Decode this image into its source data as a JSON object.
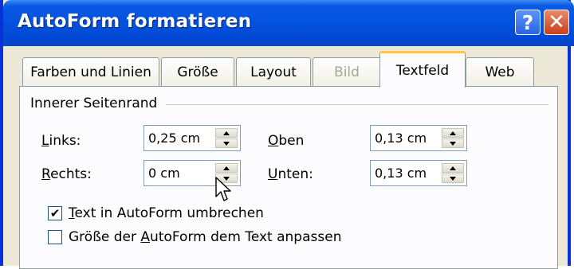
{
  "window": {
    "title": "AutoForm formatieren"
  },
  "titlebar_buttons": {
    "help": "?",
    "close": "✕"
  },
  "tabs": [
    {
      "label": "Farben und Linien",
      "state": "normal"
    },
    {
      "label": "Größe",
      "state": "normal"
    },
    {
      "label": "Layout",
      "state": "normal"
    },
    {
      "label": "Bild",
      "state": "disabled"
    },
    {
      "label": "Textfeld",
      "state": "active"
    },
    {
      "label": "Web",
      "state": "normal"
    }
  ],
  "margin_group": {
    "title": "Innerer Seitenrand",
    "links": {
      "pre": "",
      "key": "L",
      "rest": "inks:",
      "value": "0,25 cm"
    },
    "rechts": {
      "pre": "",
      "key": "R",
      "rest": "echts:",
      "value": "0 cm"
    },
    "oben": {
      "pre": "",
      "key": "O",
      "rest": "ben",
      "value": "0,13 cm"
    },
    "unten": {
      "pre": "",
      "key": "U",
      "rest": "nten:",
      "value": "0,13 cm"
    }
  },
  "options": {
    "wrap": {
      "pre": "",
      "key": "T",
      "rest": "ext in AutoForm umbrechen",
      "checked": true,
      "check_glyph": "✔"
    },
    "resize": {
      "pre": "Größe der ",
      "key": "A",
      "rest": "utoForm dem Text anpassen",
      "checked": false,
      "check_glyph": ""
    }
  },
  "colors": {
    "title_blue": "#0353e0",
    "dialog_face": "#ece9d8",
    "panel": "#fcfcfe",
    "active_tab_accent": "#ffc83c"
  }
}
